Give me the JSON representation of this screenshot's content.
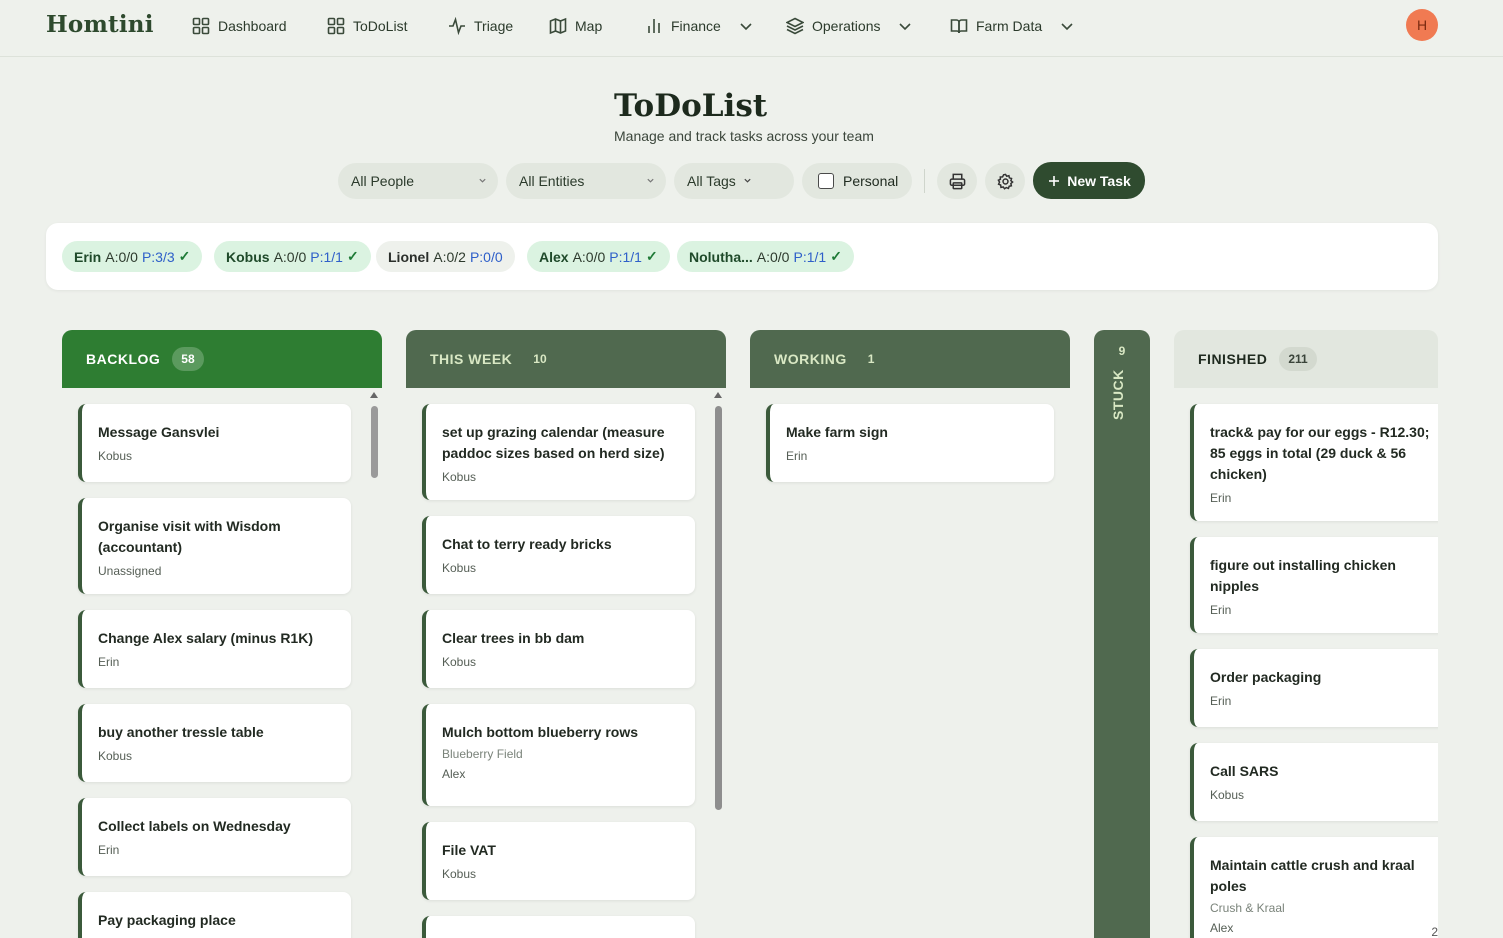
{
  "brand": "Homtini",
  "nav": {
    "dashboard": "Dashboard",
    "todolist": "ToDoList",
    "triage": "Triage",
    "map": "Map",
    "finance": "Finance",
    "operations": "Operations",
    "farm_data": "Farm Data"
  },
  "avatar_initial": "H",
  "page": {
    "title": "ToDoList",
    "subtitle": "Manage and track tasks across your team"
  },
  "filters": {
    "people": "All People",
    "entities": "All Entities",
    "tags": "All Tags",
    "personal": "Personal",
    "new_task": "New Task"
  },
  "people": [
    {
      "name": "Erin",
      "a": "A:0/0",
      "p": "P:3/3",
      "check": "✓"
    },
    {
      "name": "Kobus",
      "a": "A:0/0",
      "p": "P:1/1",
      "check": "✓"
    },
    {
      "name": "Lionel",
      "a": "A:0/2",
      "p": "P:0/0",
      "check": ""
    },
    {
      "name": "Alex",
      "a": "A:0/0",
      "p": "P:1/1",
      "check": "✓"
    },
    {
      "name": "Nolutha...",
      "a": "A:0/0",
      "p": "P:1/1",
      "check": "✓"
    }
  ],
  "columns": {
    "backlog": {
      "title": "BACKLOG",
      "count": "58",
      "cards": [
        {
          "title": "Message Gansvlei",
          "assignee": "Kobus"
        },
        {
          "title": "Organise visit with Wisdom (accountant)",
          "assignee": "Unassigned"
        },
        {
          "title": "Change Alex salary (minus R1K)",
          "assignee": "Erin"
        },
        {
          "title": "buy another tressle table",
          "assignee": "Kobus"
        },
        {
          "title": "Collect labels on Wednesday",
          "assignee": "Erin"
        },
        {
          "title": "Pay packaging place",
          "assignee": ""
        }
      ]
    },
    "this_week": {
      "title": "THIS WEEK",
      "count": "10",
      "cards": [
        {
          "title": "set up grazing calendar (measure paddoc sizes based on herd size)",
          "assignee": "Kobus"
        },
        {
          "title": "Chat to terry ready bricks",
          "assignee": "Kobus"
        },
        {
          "title": "Clear trees in bb dam",
          "assignee": "Kobus"
        },
        {
          "title": "Mulch bottom blueberry rows",
          "entity": "Blueberry Field",
          "assignee": "Alex"
        },
        {
          "title": "File VAT",
          "assignee": "Kobus"
        }
      ]
    },
    "working": {
      "title": "WORKING",
      "count": "1",
      "cards": [
        {
          "title": "Make farm sign",
          "assignee": "Erin"
        }
      ]
    },
    "stuck": {
      "title": "STUCK",
      "count": "9"
    },
    "finished": {
      "title": "FINISHED",
      "count": "211",
      "cards": [
        {
          "title": "track& pay for our eggs - R12.30; 85 eggs in total (29 duck & 56 chicken)",
          "assignee": "Erin"
        },
        {
          "title": "figure out installing chicken nipples",
          "assignee": "Erin"
        },
        {
          "title": "Order packaging",
          "assignee": "Erin"
        },
        {
          "title": "Call SARS",
          "assignee": "Kobus"
        },
        {
          "title": "Maintain cattle crush and kraal poles",
          "entity": "Crush & Kraal",
          "assignee": "Alex",
          "badge": "2"
        }
      ]
    }
  },
  "colors": {
    "backlog_header": "#2e7d32",
    "column_header": "#50694f",
    "finished_header": "#e2e7df",
    "primary_button": "#2f4b2f",
    "avatar": "#f07a52"
  }
}
